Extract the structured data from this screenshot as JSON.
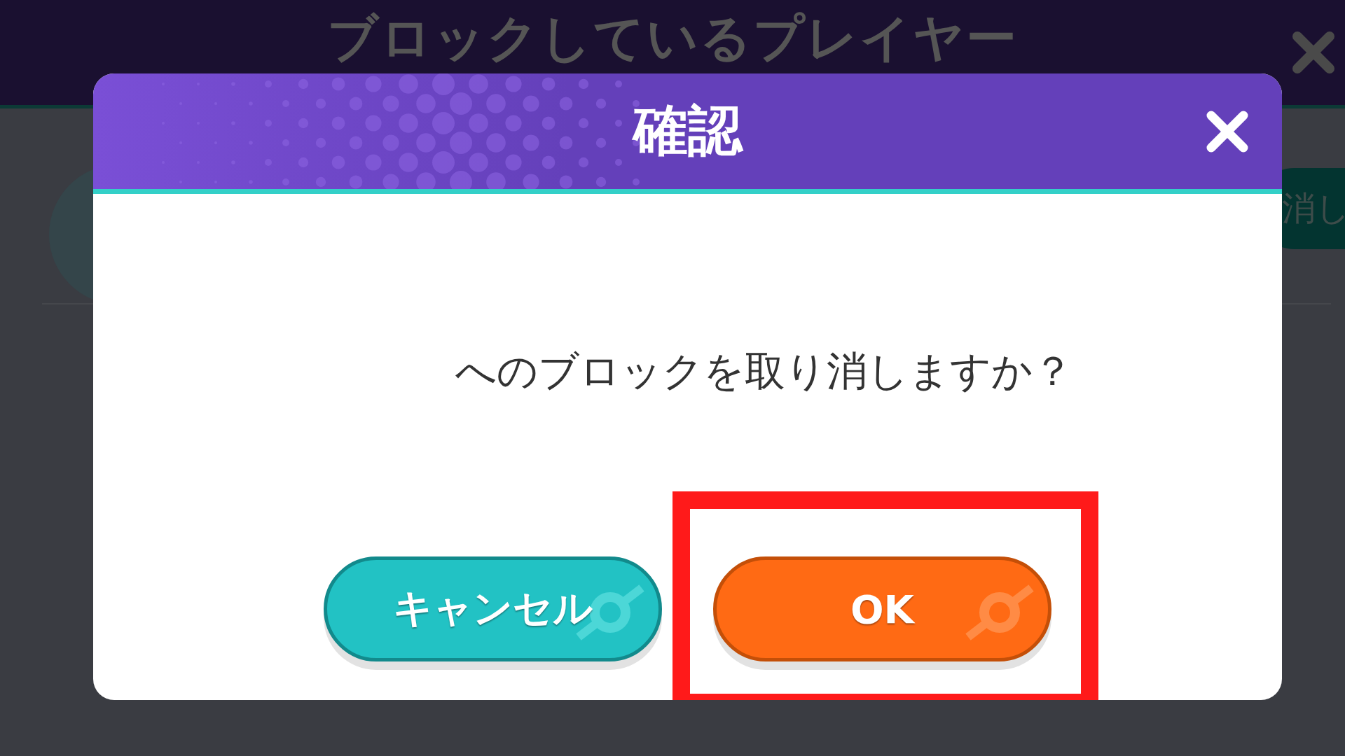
{
  "background": {
    "title": "ブロックしているプレイヤー",
    "unblock_button": "消し"
  },
  "dialog": {
    "title": "確認",
    "message": "へのブロックを取り消しますか？",
    "buttons": [
      {
        "label": "キャンセル",
        "kind": "secondary",
        "highlighted": false
      },
      {
        "label": "OK",
        "kind": "primary",
        "highlighted": true
      }
    ]
  }
}
